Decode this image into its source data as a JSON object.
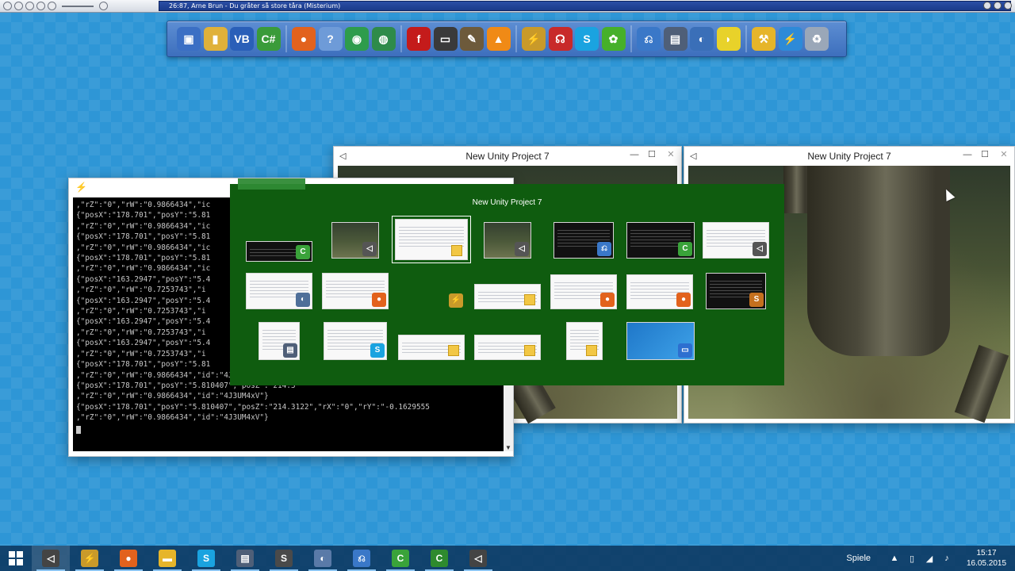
{
  "media_player": {
    "title": "26:87, Arne Brun - Du gråter så store tåra (Misterium)",
    "buttons": [
      "prev-icon",
      "play-icon",
      "pause-icon",
      "stop-icon",
      "next-icon",
      "open-icon"
    ]
  },
  "dock": {
    "icons": [
      {
        "name": "computer-icon",
        "color": "#3b6fc4",
        "glyph": "▣"
      },
      {
        "name": "user-folder-icon",
        "color": "#e0b13a",
        "glyph": "▮"
      },
      {
        "name": "vb-icon",
        "color": "#2a5fb8",
        "glyph": "VB"
      },
      {
        "name": "csharp-icon",
        "color": "#3a9b3a",
        "glyph": "C#"
      },
      {
        "name": "firefox-icon",
        "color": "#e2621d",
        "glyph": "●"
      },
      {
        "name": "help-icon",
        "color": "#6e9bd8",
        "glyph": "?"
      },
      {
        "name": "chrome-icon",
        "color": "#2e9c4c",
        "glyph": "◉"
      },
      {
        "name": "globe-icon",
        "color": "#2e8b4a",
        "glyph": "◍"
      },
      {
        "name": "flash-icon",
        "color": "#c41b1b",
        "glyph": "f"
      },
      {
        "name": "monitor-icon",
        "color": "#3a3a3a",
        "glyph": "▭"
      },
      {
        "name": "gimp-icon",
        "color": "#6d5a3b",
        "glyph": "✎"
      },
      {
        "name": "vlc-icon",
        "color": "#f08a16",
        "glyph": "▲"
      },
      {
        "name": "sword-icon",
        "color": "#c99a2a",
        "glyph": "⚡"
      },
      {
        "name": "headset-icon",
        "color": "#c82a2a",
        "glyph": "☊"
      },
      {
        "name": "skype-icon",
        "color": "#1aa3e0",
        "glyph": "S"
      },
      {
        "name": "icq-icon",
        "color": "#46b02a",
        "glyph": "✿"
      },
      {
        "name": "network-icon",
        "color": "#3a78c8",
        "glyph": "⎌"
      },
      {
        "name": "devices-icon",
        "color": "#4f5f78",
        "glyph": "▤"
      },
      {
        "name": "teamspeak-icon",
        "color": "#3a6fb8",
        "glyph": "◐"
      },
      {
        "name": "yellow-app-icon",
        "color": "#e8d22a",
        "glyph": "◗"
      },
      {
        "name": "tools-icon",
        "color": "#e6b52a",
        "glyph": "⚒"
      },
      {
        "name": "lightning-icon",
        "color": "#2d8ad8",
        "glyph": "⚡"
      },
      {
        "name": "recycle-bin-icon",
        "color": "#9aa7b8",
        "glyph": "♻"
      }
    ]
  },
  "unity_window_1": {
    "title": "New Unity Project 7"
  },
  "unity_window_2": {
    "title": "New Unity Project 7"
  },
  "console": {
    "lines": [
      ",\"rZ\":\"0\",\"rW\":\"0.9866434\",\"ic",
      "{\"posX\":\"178.701\",\"posY\":\"5.81",
      ",\"rZ\":\"0\",\"rW\":\"0.9866434\",\"ic",
      "{\"posX\":\"178.701\",\"posY\":\"5.81",
      ",\"rZ\":\"0\",\"rW\":\"0.9866434\",\"ic",
      "{\"posX\":\"178.701\",\"posY\":\"5.81",
      ",\"rZ\":\"0\",\"rW\":\"0.9866434\",\"ic",
      "{\"posX\":\"163.2947\",\"posY\":\"5.4",
      ",\"rZ\":\"0\",\"rW\":\"0.7253743\",\"i",
      "{\"posX\":\"163.2947\",\"posY\":\"5.4",
      ",\"rZ\":\"0\",\"rW\":\"0.7253743\",\"i",
      "{\"posX\":\"163.2947\",\"posY\":\"5.4",
      ",\"rZ\":\"0\",\"rW\":\"0.7253743\",\"i",
      "{\"posX\":\"163.2947\",\"posY\":\"5.4",
      ",\"rZ\":\"0\",\"rW\":\"0.7253743\",\"i",
      "{\"posX\":\"178.701\",\"posY\":\"5.81",
      ",\"rZ\":\"0\",\"rW\":\"0.9866434\",\"id\":\"4J3UM4xV\"}",
      "{\"posX\":\"178.701\",\"posY\":\"5.810407\",\"posZ\":\"214.3",
      ",\"rZ\":\"0\",\"rW\":\"0.9866434\",\"id\":\"4J3UM4xV\"}",
      "{\"posX\":\"178.701\",\"posY\":\"5.810407\",\"posZ\":\"214.3122\",\"rX\":\"0\",\"rY\":\"-0.1629555",
      ",\"rZ\":\"0\",\"rW\":\"0.9866434\",\"id\":\"4J3UM4xV\"}"
    ]
  },
  "switcher": {
    "title": "New Unity Project 7",
    "thumbnails": [
      {
        "type": "dark",
        "badge": "C",
        "badge_color": "#3aa33a",
        "selected": false
      },
      {
        "type": "game",
        "badge": "◁",
        "badge_color": "#555555",
        "selected": false
      },
      {
        "type": "light",
        "badge": "folder",
        "badge_color": "#f2c744",
        "selected": true
      },
      {
        "type": "game",
        "badge": "◁",
        "badge_color": "#555555",
        "selected": false
      },
      {
        "type": "dark",
        "badge": "⎌",
        "badge_color": "#3a78c8",
        "selected": false
      },
      {
        "type": "dark",
        "badge": "C",
        "badge_color": "#3aa33a",
        "selected": false
      },
      {
        "type": "light",
        "badge": "◁",
        "badge_color": "#555555",
        "selected": false
      },
      {
        "type": "light",
        "badge": "◐",
        "badge_color": "#4f6f99",
        "selected": false
      },
      {
        "type": "light",
        "badge": "●",
        "badge_color": "#e2621d",
        "selected": false
      },
      {
        "type": "green",
        "badge": "⚡",
        "badge_color": "#c99a2a",
        "selected": false
      },
      {
        "type": "light",
        "badge": "folder",
        "badge_color": "#f2c744",
        "selected": false
      },
      {
        "type": "light",
        "badge": "●",
        "badge_color": "#e2621d",
        "selected": false
      },
      {
        "type": "light",
        "badge": "●",
        "badge_color": "#e2621d",
        "selected": false
      },
      {
        "type": "dark",
        "badge": "S",
        "badge_color": "#c4701e",
        "selected": false
      },
      {
        "type": "light",
        "badge": "▤",
        "badge_color": "#4f5f78",
        "selected": false
      },
      {
        "type": "light",
        "badge": "S",
        "badge_color": "#1aa3e0",
        "selected": false
      },
      {
        "type": "light",
        "badge": "folder",
        "badge_color": "#f2c744",
        "selected": false
      },
      {
        "type": "light",
        "badge": "folder",
        "badge_color": "#f2c744",
        "selected": false
      },
      {
        "type": "light",
        "badge": "folder",
        "badge_color": "#f2c744",
        "selected": false
      },
      {
        "type": "blue",
        "badge": "▭",
        "badge_color": "#2d6fd0",
        "selected": false
      }
    ]
  },
  "taskbar": {
    "apps": [
      {
        "name": "taskbar-unity",
        "glyph": "◁",
        "color": "#444444",
        "open": true
      },
      {
        "name": "taskbar-sword-app",
        "glyph": "⚡",
        "color": "#c99a2a",
        "open": true
      },
      {
        "name": "taskbar-firefox",
        "glyph": "●",
        "color": "#e2621d",
        "open": true
      },
      {
        "name": "taskbar-explorer",
        "glyph": "▬",
        "color": "#e6b52a",
        "open": true
      },
      {
        "name": "taskbar-skype",
        "glyph": "S",
        "color": "#1aa3e0",
        "open": true
      },
      {
        "name": "taskbar-devices",
        "glyph": "▤",
        "color": "#4f5f78",
        "open": true
      },
      {
        "name": "taskbar-sublime",
        "glyph": "S",
        "color": "#4a4a4a",
        "open": true
      },
      {
        "name": "taskbar-teamspeak",
        "glyph": "◐",
        "color": "#5a7aa8",
        "open": true
      },
      {
        "name": "taskbar-network",
        "glyph": "⎌",
        "color": "#3a78c8",
        "open": true
      },
      {
        "name": "taskbar-console-c1",
        "glyph": "C",
        "color": "#3aa33a",
        "open": true
      },
      {
        "name": "taskbar-console-c2",
        "glyph": "C",
        "color": "#2e8a2e",
        "open": true
      },
      {
        "name": "taskbar-unity-2",
        "glyph": "◁",
        "color": "#444444",
        "open": true
      }
    ],
    "tray_label": "Spiele",
    "time": "15:17",
    "date": "16.05.2015"
  }
}
